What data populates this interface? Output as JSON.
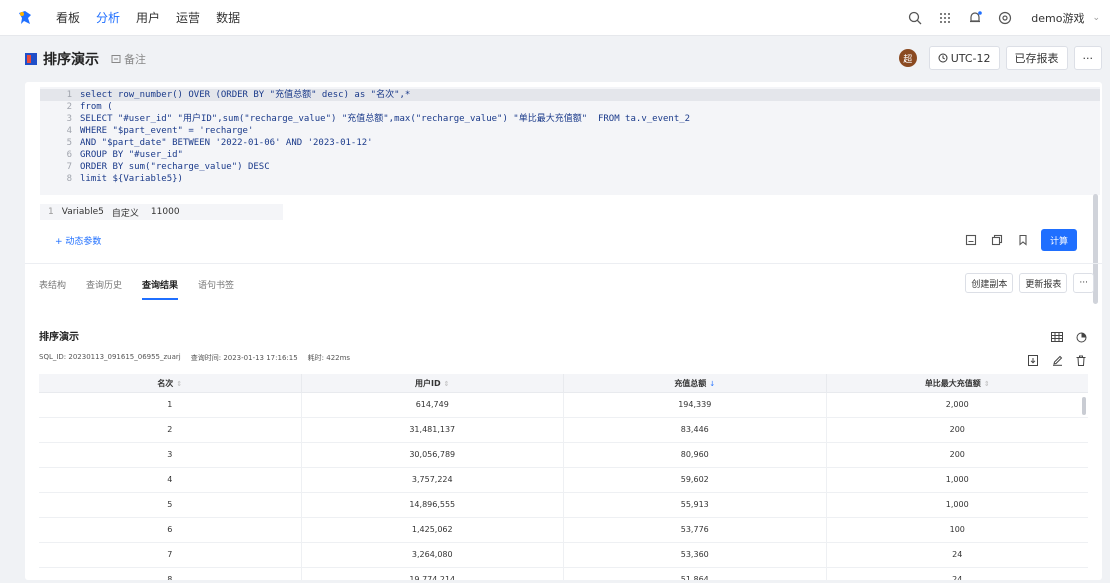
{
  "nav": {
    "items": [
      {
        "label": "看板",
        "active": false
      },
      {
        "label": "分析",
        "active": true
      },
      {
        "label": "用户",
        "active": false
      },
      {
        "label": "运营",
        "active": false
      },
      {
        "label": "数据",
        "active": false
      }
    ],
    "user": "demo游戏",
    "accent": "#1f6fff"
  },
  "header": {
    "title": "排序演示",
    "note": "备注",
    "avatar": "超",
    "timezone": "UTC-12",
    "saved_report": "已存报表",
    "more": "···"
  },
  "editor": {
    "lines": [
      {
        "n": "1",
        "code": "select row_number() OVER (ORDER BY \"充值总额\" desc) as \"名次\",*"
      },
      {
        "n": "2",
        "code": "from ("
      },
      {
        "n": "3",
        "code": "SELECT \"#user_id\" \"用户ID\",sum(\"recharge_value\") \"充值总额\",max(\"recharge_value\") \"单比最大充值额\"  FROM ta.v_event_2"
      },
      {
        "n": "4",
        "code": "WHERE \"$part_event\" = 'recharge'"
      },
      {
        "n": "5",
        "code": "AND \"$part_date\" BETWEEN '2022-01-06' AND '2023-01-12'"
      },
      {
        "n": "6",
        "code": "GROUP BY \"#user_id\""
      },
      {
        "n": "7",
        "code": "ORDER BY sum(\"recharge_value\") DESC"
      },
      {
        "n": "8",
        "code": "limit ${Variable5})"
      }
    ],
    "variable": {
      "n": "1",
      "name": "Variable5",
      "type": "自定义",
      "value": "11000"
    },
    "dynamic_param": "+ 动态参数",
    "run": "计算"
  },
  "tabs": {
    "items": [
      {
        "label": "表结构",
        "active": false
      },
      {
        "label": "查询历史",
        "active": false
      },
      {
        "label": "查询结果",
        "active": true
      },
      {
        "label": "语句书签",
        "active": false
      }
    ],
    "create_copy": "创建副本",
    "update_report": "更新报表",
    "more": "···"
  },
  "result": {
    "title": "排序演示",
    "sql_id": "SQL_ID: 20230113_091615_06955_zuarj",
    "query_time": "查询时间: 2023-01-13 17:16:15",
    "elapsed": "耗时: 422ms",
    "columns": [
      {
        "label": "名次",
        "sort": "⇕",
        "active": false
      },
      {
        "label": "用户ID",
        "sort": "⇕",
        "active": false
      },
      {
        "label": "充值总额",
        "sort": "↓",
        "active": true
      },
      {
        "label": "单比最大充值额",
        "sort": "⇕",
        "active": false
      }
    ],
    "rows": [
      [
        "1",
        "614,749",
        "194,339",
        "2,000"
      ],
      [
        "2",
        "31,481,137",
        "83,446",
        "200"
      ],
      [
        "3",
        "30,056,789",
        "80,960",
        "200"
      ],
      [
        "4",
        "3,757,224",
        "59,602",
        "1,000"
      ],
      [
        "5",
        "14,896,555",
        "55,913",
        "1,000"
      ],
      [
        "6",
        "1,425,062",
        "53,776",
        "100"
      ],
      [
        "7",
        "3,264,080",
        "53,360",
        "24"
      ],
      [
        "8",
        "19,774,214",
        "51,864",
        "24"
      ]
    ]
  }
}
